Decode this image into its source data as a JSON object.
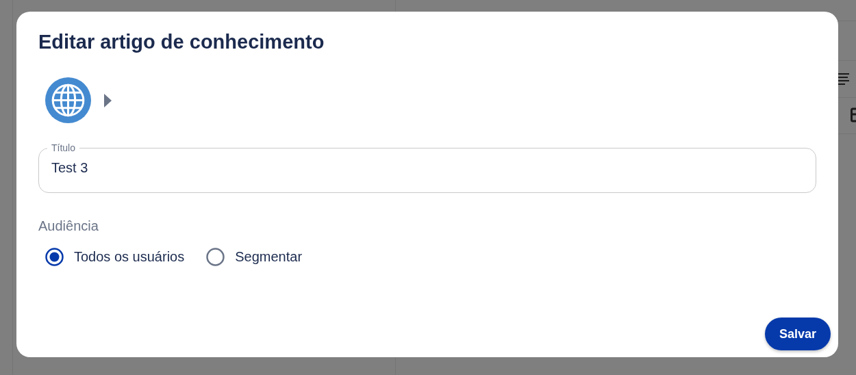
{
  "dialog": {
    "title": "Editar artigo de conhecimento",
    "title_field": {
      "label": "Título",
      "value": "Test 3"
    },
    "audience": {
      "label": "Audiência",
      "options": [
        {
          "label": "Todos os usuários",
          "selected": true
        },
        {
          "label": "Segmentar",
          "selected": false
        }
      ]
    },
    "buttons": [
      {
        "label": "Salvar"
      }
    ]
  }
}
